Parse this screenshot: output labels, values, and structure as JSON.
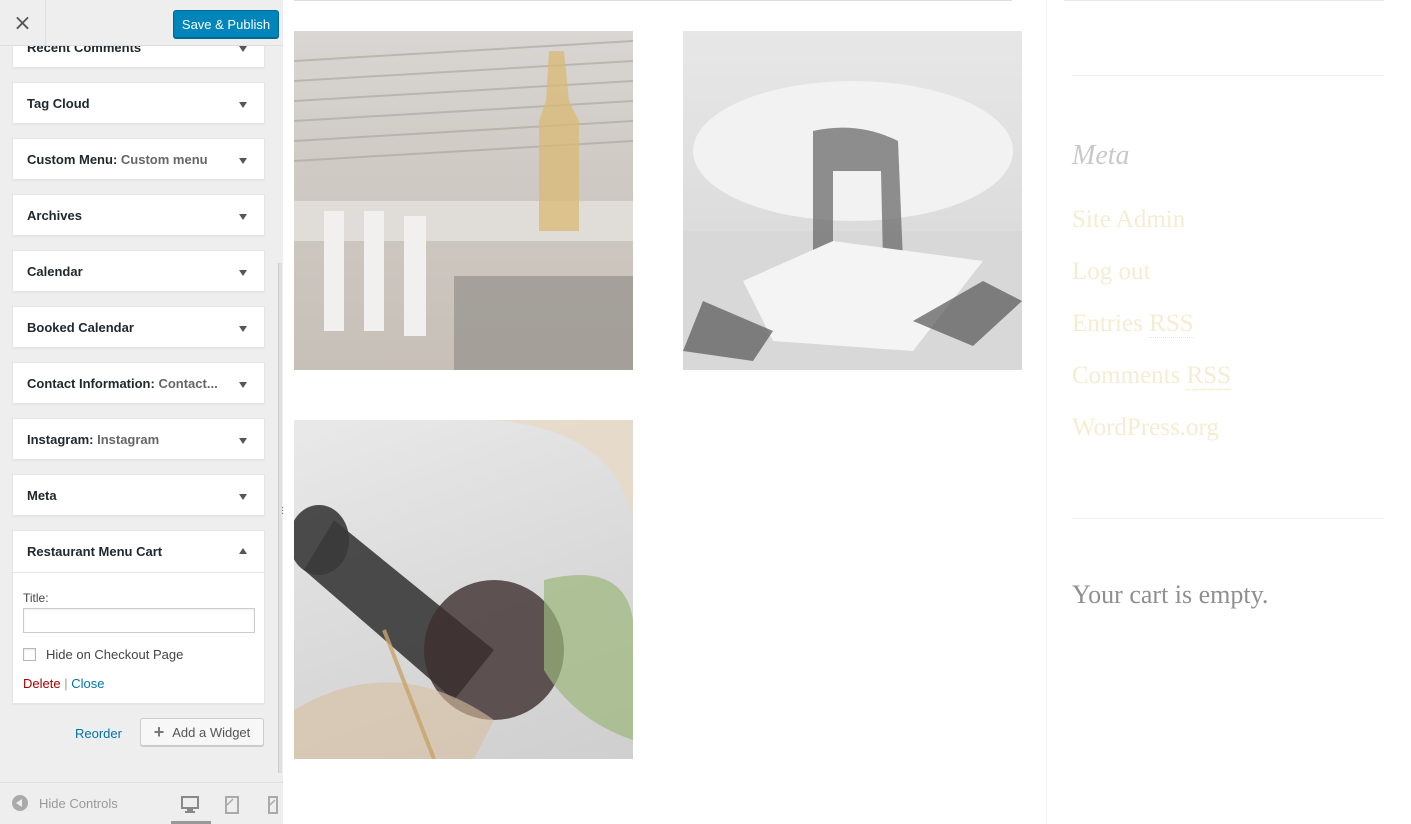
{
  "topbar": {
    "close_icon": "×",
    "save_label": "Save & Publish",
    "save_color": "#0085ba"
  },
  "widgets": [
    {
      "title": "Recent Comments",
      "instance": ""
    },
    {
      "title": "Tag Cloud",
      "instance": ""
    },
    {
      "title": "Custom Menu:",
      "instance": "Custom menu"
    },
    {
      "title": "Archives",
      "instance": ""
    },
    {
      "title": "Calendar",
      "instance": ""
    },
    {
      "title": "Booked Calendar",
      "instance": ""
    },
    {
      "title": "Contact Information:",
      "instance": "Contact..."
    },
    {
      "title": "Instagram:",
      "instance": "Instagram"
    },
    {
      "title": "Meta",
      "instance": ""
    }
  ],
  "open_widget": {
    "title": "Restaurant Menu Cart",
    "title_label": "Title:",
    "title_value": "",
    "checkbox_label": "Hide on Checkout Page",
    "checkbox_checked": false,
    "delete_label": "Delete",
    "separator": "|",
    "close_label": "Close"
  },
  "widget_actions": {
    "reorder_label": "Reorder",
    "add_label": "Add a Widget",
    "add_icon": "+"
  },
  "footer": {
    "hide_controls_label": "Hide Controls",
    "devices": [
      "desktop-icon",
      "tablet-icon",
      "mobile-icon"
    ],
    "active_device": "desktop"
  },
  "preview": {
    "meta_heading": "Meta",
    "meta_links": [
      {
        "text": "Site Admin",
        "abbr": ""
      },
      {
        "text": "Log out",
        "abbr": ""
      },
      {
        "text": "Entries ",
        "abbr": "RSS"
      },
      {
        "text": "Comments ",
        "abbr": "RSS"
      },
      {
        "text": "WordPress.org",
        "abbr": ""
      }
    ],
    "cart_text": "Your cart is empty.",
    "link_color": "#f6ecd2"
  }
}
